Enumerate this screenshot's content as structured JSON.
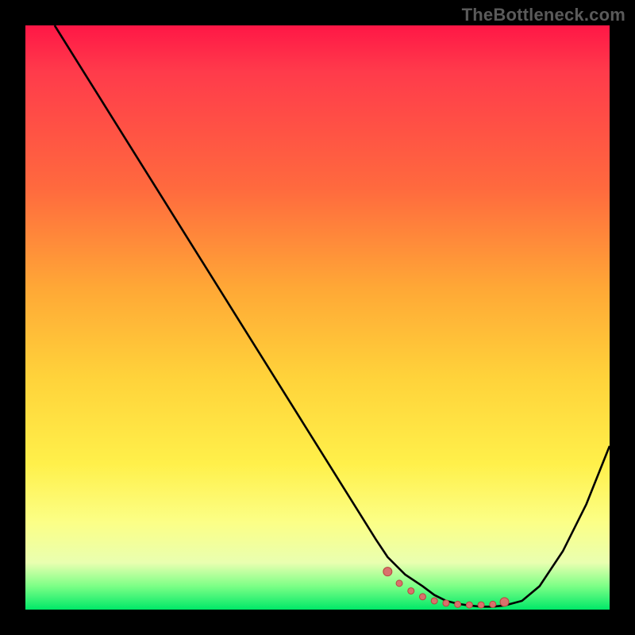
{
  "watermark": "TheBottleneck.com",
  "colors": {
    "background": "#000000",
    "curve_stroke": "#000000",
    "marker_fill": "#d9716c",
    "marker_stroke": "#b8463f"
  },
  "chart_data": {
    "type": "line",
    "title": "",
    "xlabel": "",
    "ylabel": "",
    "xlim": [
      0,
      100
    ],
    "ylim": [
      0,
      100
    ],
    "x": [
      5,
      10,
      15,
      20,
      25,
      30,
      35,
      40,
      45,
      50,
      55,
      60,
      62,
      65,
      68,
      70,
      72,
      74,
      76,
      78,
      80,
      82,
      85,
      88,
      92,
      96,
      100
    ],
    "values": [
      100,
      92,
      84,
      76,
      68,
      60,
      52,
      44,
      36,
      28,
      20,
      12,
      9,
      6,
      4,
      2.5,
      1.5,
      1,
      0.7,
      0.5,
      0.5,
      0.7,
      1.5,
      4,
      10,
      18,
      28
    ],
    "markers": {
      "x": [
        62,
        64,
        66,
        68,
        70,
        72,
        74,
        76,
        78,
        80,
        82
      ],
      "y": [
        6.5,
        4.5,
        3.2,
        2.2,
        1.5,
        1.1,
        0.9,
        0.8,
        0.8,
        0.9,
        1.3
      ]
    }
  }
}
